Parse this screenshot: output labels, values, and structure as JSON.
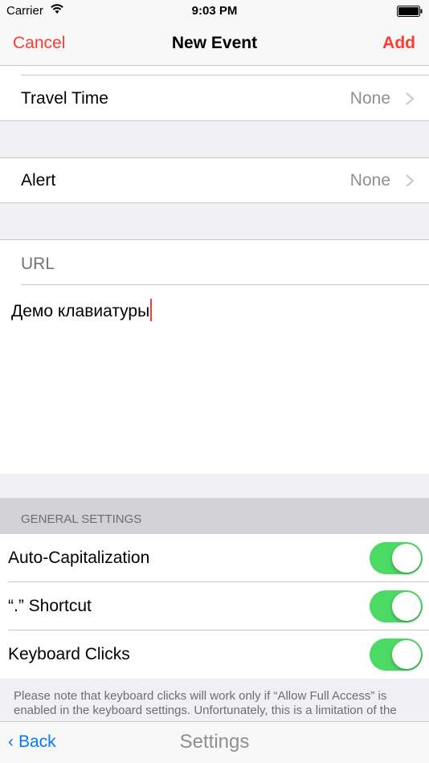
{
  "status_bar": {
    "carrier": "Carrier",
    "time": "9:03 PM"
  },
  "nav": {
    "cancel": "Cancel",
    "title": "New Event",
    "add": "Add"
  },
  "rows": {
    "travel_time": {
      "label": "Travel Time",
      "value": "None"
    },
    "alert": {
      "label": "Alert",
      "value": "None"
    }
  },
  "url_field": {
    "placeholder": "URL"
  },
  "notes": {
    "text": "Демо клавиатуры"
  },
  "settings": {
    "header": "GENERAL SETTINGS",
    "items": [
      {
        "label": "Auto-Capitalization",
        "on": true
      },
      {
        "label": "“.” Shortcut",
        "on": true
      },
      {
        "label": "Keyboard Clicks",
        "on": true
      }
    ],
    "note": "Please note that keyboard clicks will work only if “Allow Full Access” is enabled in the keyboard settings. Unfortunately, this is a limitation of the"
  },
  "bottom_bar": {
    "back": "Back",
    "title": "Settings"
  },
  "colors": {
    "accent_red": "#ff3b30",
    "accent_blue": "#007aff",
    "toggle_green": "#4cd964"
  }
}
